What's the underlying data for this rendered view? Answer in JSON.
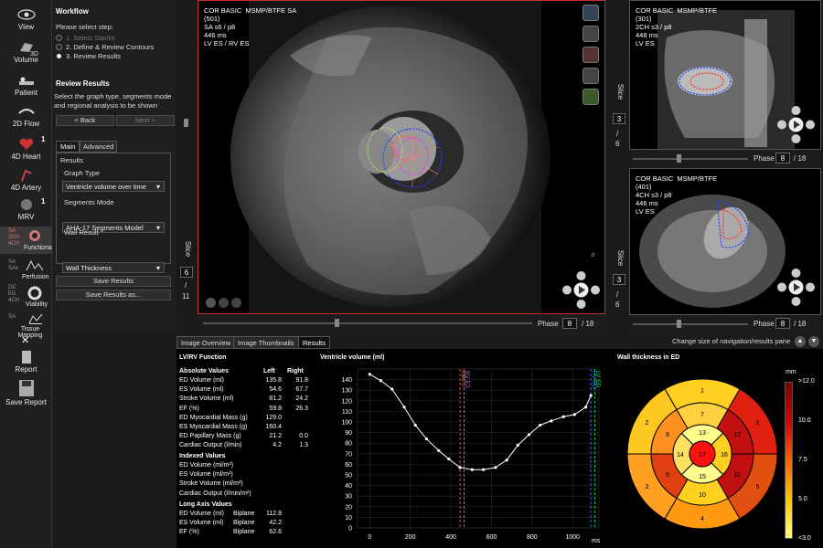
{
  "toolbar": {
    "items": [
      {
        "label": "View",
        "icon": "eye-icon"
      },
      {
        "label": "3D",
        "icon": "3d-icon"
      },
      {
        "label": "Volume",
        "icon": "volume-icon"
      },
      {
        "label": "Patient",
        "icon": "patient-icon"
      },
      {
        "label": "2D Flow",
        "icon": "flow-icon"
      },
      {
        "label": "4D Heart",
        "icon": "heart-icon"
      },
      {
        "label": "4D Artery",
        "icon": "artery-icon"
      },
      {
        "label": "MRV",
        "icon": "mrv-icon"
      },
      {
        "label": "Functional",
        "icon": "functional-icon"
      },
      {
        "label": "Perfusion",
        "icon": "perfusion-icon"
      },
      {
        "label": "Viability",
        "icon": "viability-icon"
      },
      {
        "label": "Tissue Mapping",
        "icon": "mapping-icon"
      },
      {
        "label": "Report",
        "icon": "report-icon"
      },
      {
        "label": "Save Report",
        "icon": "save-icon"
      }
    ],
    "side_tags": {
      "sa": "SA",
      "ch2": "2CH",
      "ch4": "4CH",
      "sa2": "SA",
      "sax": "SAx",
      "de": "DE",
      "ed": "ED",
      "ch4b": "4CH",
      "sa3": "SA"
    },
    "badge": "1",
    "close": "✕"
  },
  "workflow": {
    "title": "Workflow",
    "prompt": "Please select step:",
    "steps": [
      "1. Select Stacks",
      "2. Define & Review Contours",
      "3. Review Results"
    ],
    "review_title": "Review Results",
    "review_desc": "Select the graph type, segments mode and regional analysis to be shown",
    "back": "< Back",
    "next": "Next >",
    "tabs": [
      "Main",
      "Advanced"
    ],
    "results_label": "Results",
    "graph_type_label": "Graph Type",
    "graph_type_value": "Ventricle volume over time",
    "segments_label": "Segments Mode",
    "segments_value": "AHA-17 Segments Model",
    "wall_label": "Wall Result",
    "wall_value": "Wall Thickness",
    "save_results": "Save Results",
    "save_as": "Save Results as..."
  },
  "main_viewer": {
    "info": "COR BASIC  MSMP/BTFE SA\n(501)\nSA s6 / p8\n446 ms\nLV ES / RV ES",
    "slice_label": "Slice",
    "slice_value": "6",
    "slice_sep": "/",
    "slice_total": "11",
    "phase_label": "Phase",
    "phase_value": "8",
    "phase_total": "18"
  },
  "top_viewer": {
    "info": "COR BASIC  MSMP/BTFE\n(301)\n2CH s3 / p8\n448 ms\nLV ES",
    "slice_label": "Slice",
    "slice_value": "3",
    "slice_total": "6",
    "phase_label": "Phase",
    "phase_value": "8",
    "phase_total": "18"
  },
  "bottom_viewer": {
    "info": "COR BASIC  MSMP/BTFE\n(401)\n4CH s3 / p8\n446 ms\nLV ES",
    "slice_label": "Slice",
    "slice_value": "3",
    "slice_total": "6",
    "phase_label": "Phase",
    "phase_value": "8",
    "phase_total": "18"
  },
  "results_tabs": [
    "Image Overview",
    "Image Thumbnails",
    "Results"
  ],
  "pane_hint": "Change size of navigation/results pane",
  "lvrv": {
    "title": "LV/RV Function",
    "abs_title": "Absolute Values",
    "col_left": "Left",
    "col_right": "Right",
    "rows": [
      {
        "label": "ED Volume (ml)",
        "l": "135.8",
        "r": "91.8"
      },
      {
        "label": "ES Volume (ml)",
        "l": "54.6",
        "r": "67.7"
      },
      {
        "label": "Stroke Volume (ml)",
        "l": "81.2",
        "r": "24.2"
      },
      {
        "label": "EF (%)",
        "l": "59.8",
        "r": "26.3"
      },
      {
        "label": "ED Myocardial Mass (g)",
        "l": "129.0",
        "r": ""
      },
      {
        "label": "ES Myocardial Mass (g)",
        "l": "160.4",
        "r": ""
      },
      {
        "label": "ED Papillary Mass (g)",
        "l": "21.2",
        "r": "0.0"
      },
      {
        "label": "Cardiac Output (l/min)",
        "l": "4.2",
        "r": "1.3"
      }
    ],
    "indexed_title": "Indexed Values",
    "indexed_rows": [
      "ED Volume (ml/m²)",
      "ES Volume (ml/m²)",
      "Stroke Volume (ml/m²)",
      "Cardiac Output (l/min/m²)"
    ],
    "long_title": "Long Axis Values",
    "long_rows": [
      {
        "label": "ED Volume (ml)",
        "m": "Biplane",
        "v": "112.8"
      },
      {
        "label": "ES Volume (ml)",
        "m": "Biplane",
        "v": "42.2"
      },
      {
        "label": "EF (%)",
        "m": "Biplane",
        "v": "62.6"
      }
    ]
  },
  "chart_data": {
    "type": "line",
    "title": "Ventricle volume (ml)",
    "xlabel": "ms",
    "ylabel": "",
    "x": [
      0,
      55,
      110,
      170,
      225,
      280,
      340,
      390,
      445,
      505,
      560,
      620,
      675,
      730,
      785,
      840,
      895,
      955,
      1010,
      1065,
      1090
    ],
    "y": [
      145,
      139,
      131,
      114,
      97,
      84,
      73,
      65,
      57,
      55,
      55,
      57,
      64,
      78,
      88,
      97,
      101,
      105,
      107,
      114,
      125
    ],
    "xlim": [
      -60,
      1130
    ],
    "ylim": [
      0,
      150
    ],
    "xticks": [
      0,
      200,
      400,
      600,
      800,
      1000
    ],
    "yticks": [
      0,
      10,
      20,
      30,
      40,
      50,
      60,
      70,
      80,
      90,
      100,
      110,
      120,
      130,
      140
    ],
    "markers": [
      {
        "x": 445,
        "label": "ES",
        "color": "#e8c228"
      },
      {
        "x": 445,
        "label": "LV ES",
        "color": "#e04040"
      },
      {
        "x": 465,
        "label": "RV ES",
        "color": "#c050ff"
      },
      {
        "x": 1090,
        "label": "RV ED",
        "color": "#3a6bff"
      },
      {
        "x": 1110,
        "label": "LV ED",
        "color": "#22c93a"
      }
    ],
    "grid": true
  },
  "bullseye": {
    "title": "Wall thickness in ED",
    "unit": "mm",
    "scale_labels": [
      ">12.0",
      "10.0",
      "7.5",
      "5.0",
      "<3.0"
    ],
    "colorbar_colors": [
      "#7a0000",
      "#d40000",
      "#ff6000",
      "#ffc400",
      "#ffff80"
    ],
    "segments": {
      "s1": "#ffd020",
      "s2": "#ffc820",
      "s3": "#ffa020",
      "s4": "#ff9a10",
      "s5": "#e05010",
      "s6": "#e02010",
      "s7": "#ffd040",
      "s8": "#ff9020",
      "s9": "#e04010",
      "s10": "#ffd020",
      "s11": "#c01010",
      "s12": "#c01010",
      "s13": "#ffff90",
      "s14": "#ffe060",
      "s15": "#ffff90",
      "s16": "#ffd020",
      "s17": "#ff1010"
    },
    "labels": [
      "1",
      "2",
      "3",
      "4",
      "5",
      "6",
      "7",
      "8",
      "9",
      "10",
      "11",
      "12",
      "13",
      "14",
      "15",
      "16",
      "17"
    ]
  }
}
